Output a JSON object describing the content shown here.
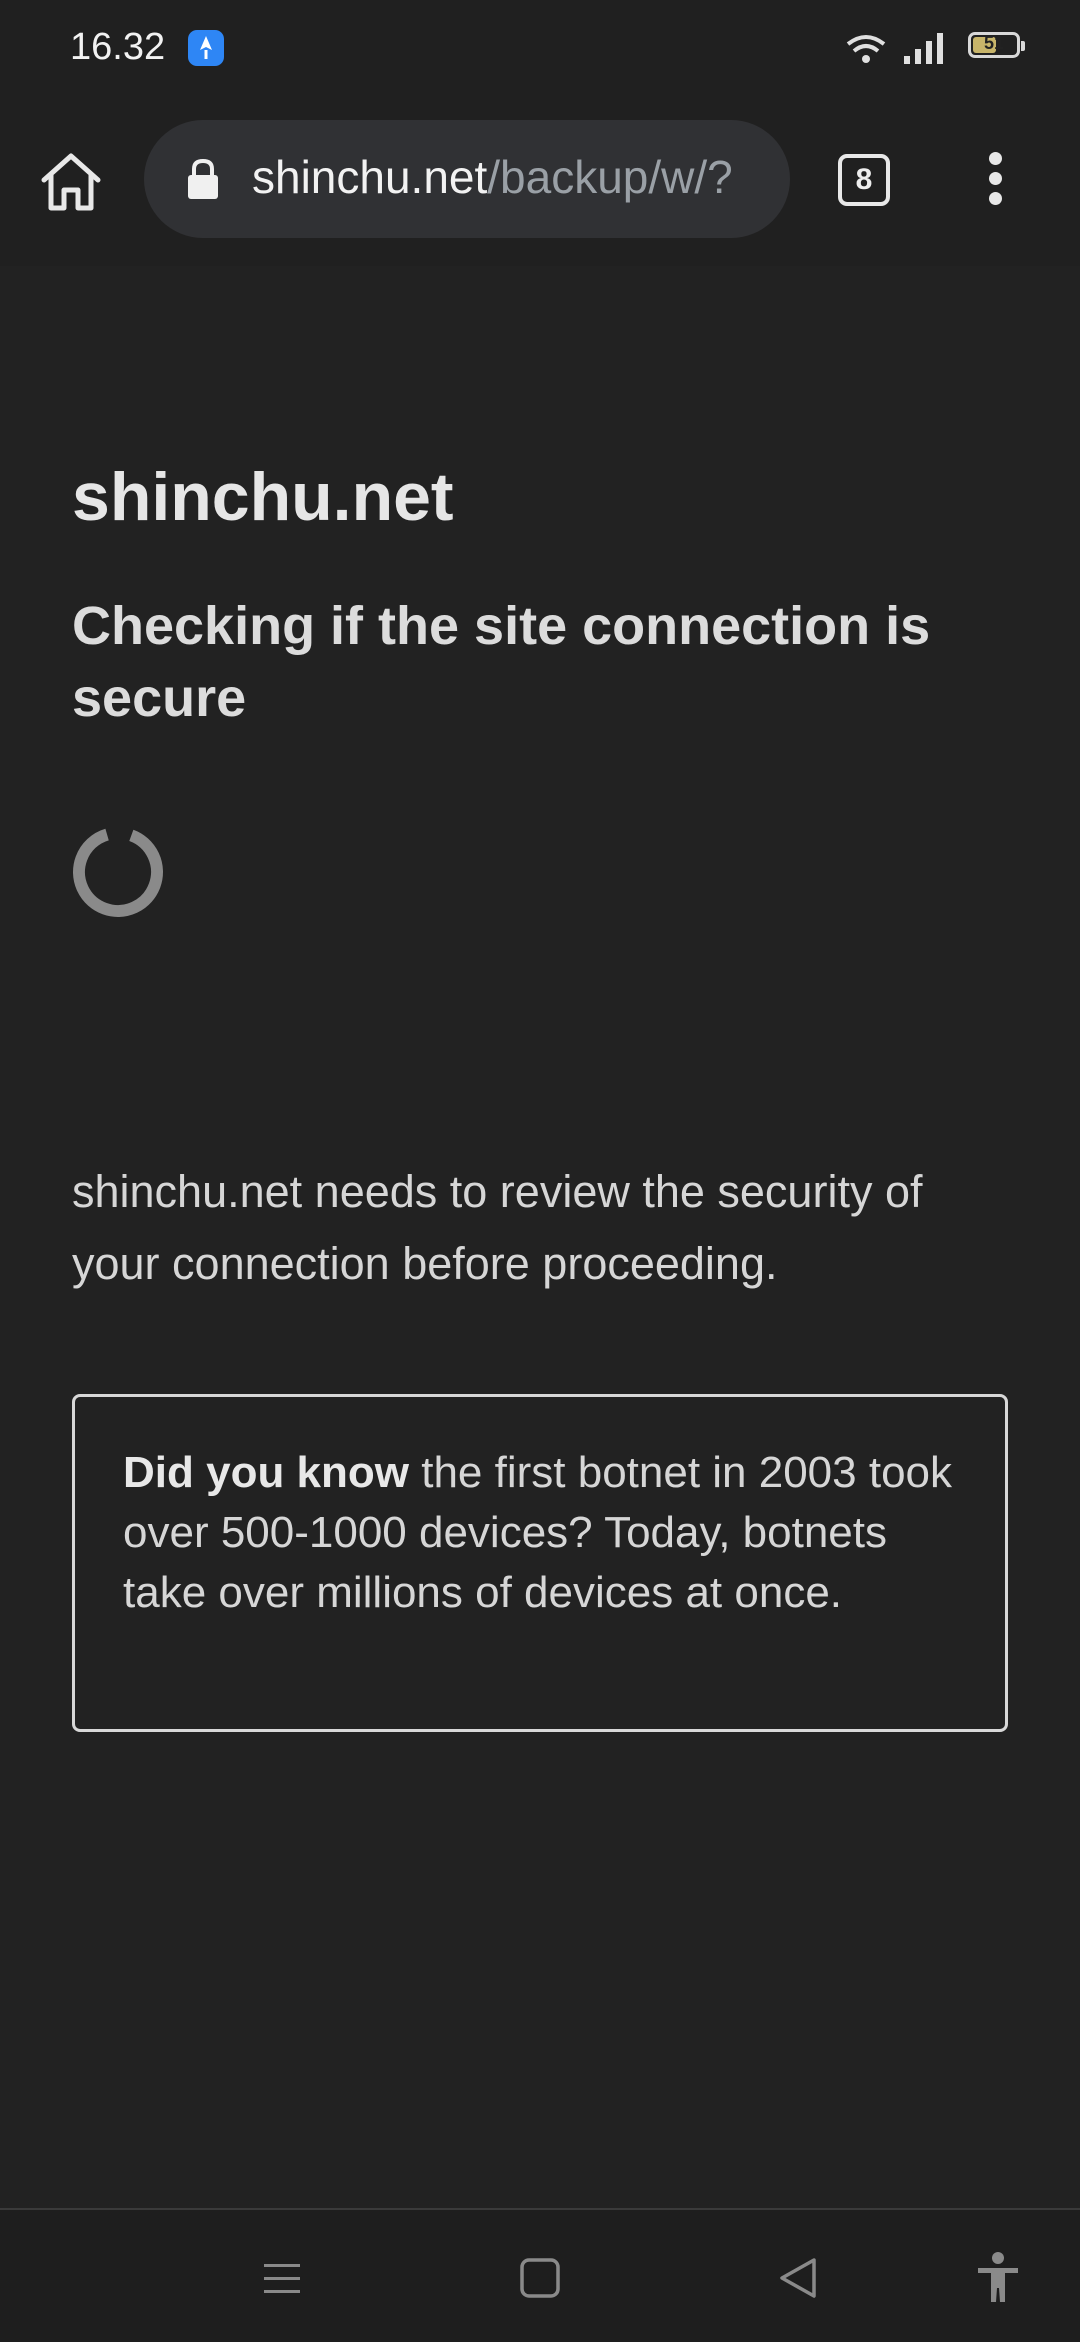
{
  "status_bar": {
    "time": "16.32",
    "battery_level": "51",
    "icons": [
      "app-notification-icon",
      "wifi-icon",
      "signal-icon",
      "battery-icon"
    ]
  },
  "toolbar": {
    "url_domain": "shinchu.net",
    "url_path": "/backup/w/?",
    "tab_count": "8"
  },
  "page": {
    "site_name": "shinchu.net",
    "heading": "Checking if the site connection is secure",
    "review_text": "shinchu.net needs to review the security of your connection before proceeding.",
    "fact_bold": "Did you know",
    "fact_text": " the first botnet in 2003 took over 500-1000 devices? Today, botnets take over millions of devices at once."
  },
  "colors": {
    "background": "#222222",
    "toolbar": "#202020",
    "omnibox": "#303134",
    "accent_notification": "#2e86f5",
    "spinner": "#8a8a8a"
  }
}
